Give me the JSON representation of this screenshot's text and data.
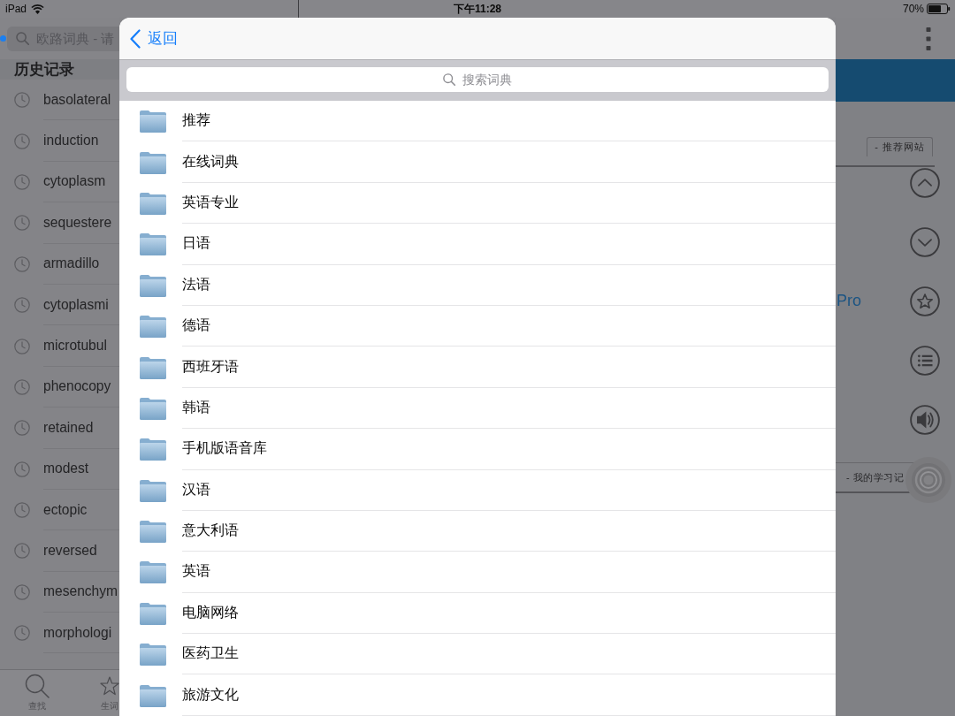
{
  "status_bar": {
    "carrier": "iPad",
    "time": "下午11:28",
    "battery": "70%"
  },
  "sidebar": {
    "search": {
      "placeholder": "欧路词典 - 请"
    },
    "section_title": "历史记录",
    "history": [
      "basolateral",
      "induction",
      "cytoplasm",
      "sequestere",
      "armadillo",
      "cytoplasmi",
      "microtubul",
      "phenocopy",
      "retained",
      "modest",
      "ectopic",
      "reversed",
      "mesenchym",
      "morphologi"
    ]
  },
  "tab_bar": {
    "tabs": [
      {
        "kind": "search",
        "label": "查找"
      },
      {
        "kind": "star",
        "label": "生词"
      }
    ]
  },
  "content": {
    "section_headers": [
      "- 推荐网站",
      "- 我的学习记"
    ],
    "link": "Pro",
    "side_buttons": [
      {
        "kind": "up"
      },
      {
        "kind": "down"
      },
      {
        "kind": "star"
      },
      {
        "kind": "list"
      },
      {
        "kind": "speaker"
      }
    ]
  },
  "sheet": {
    "back_button": "返回",
    "search": {
      "placeholder": "搜索词典"
    },
    "folders": [
      "推荐",
      "在线词典",
      "英语专业",
      "日语",
      "法语",
      "德语",
      "西班牙语",
      "韩语",
      "手机版语音库",
      "汉语",
      "意大利语",
      "英语",
      "电脑网络",
      "医药卫生",
      "旅游文化"
    ]
  }
}
